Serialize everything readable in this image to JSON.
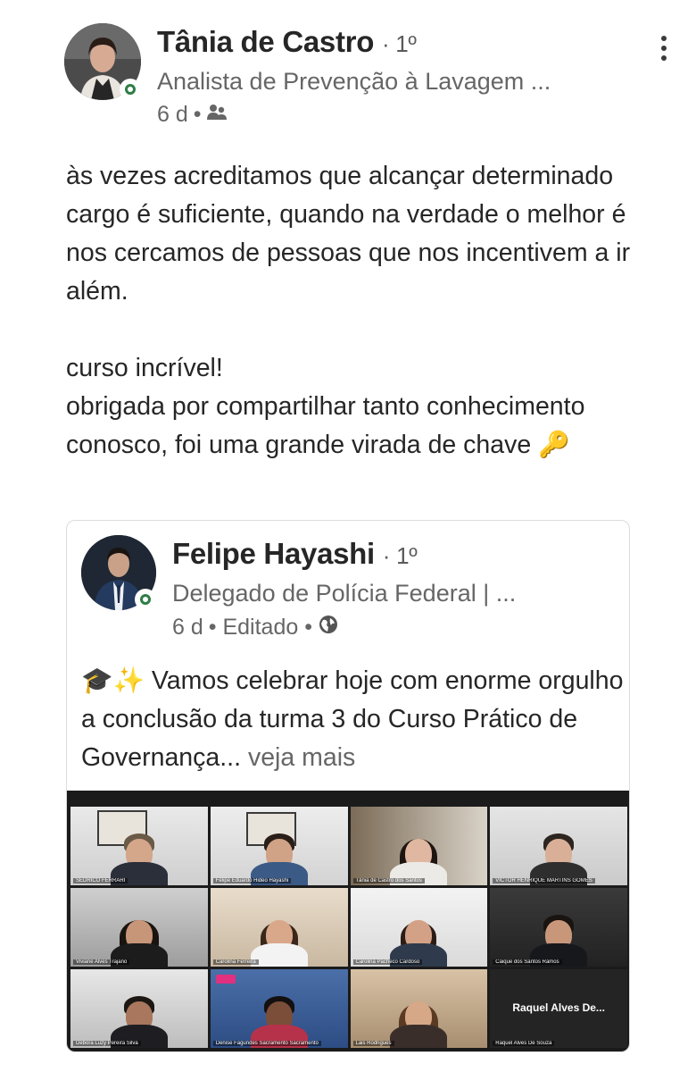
{
  "post": {
    "author": {
      "name": "Tânia de Castro",
      "degree": "· 1º",
      "headline": "Analista de Prevenção à Lavagem ...",
      "time": "6 d",
      "separator": "•",
      "visibility_icon": "connections-icon"
    },
    "text": "às vezes acreditamos que alcançar determinado cargo é suficiente, quando na verdade o melhor é nos cercamos de pessoas que nos incentivem a ir além.\n\ncurso incrível!\nobrigada por compartilhar tanto conhecimento conosco, foi uma grande virada de chave 🔑"
  },
  "shared": {
    "author": {
      "name": "Felipe Hayashi",
      "degree": "· 1º",
      "headline": "Delegado de Polícia Federal | ...",
      "time": "6 d",
      "edited": "• Editado •",
      "visibility_icon": "globe-icon"
    },
    "text": "🎓✨ Vamos celebrar hoje com enorme orgulho a conclusão da turma 3 do Curso Prático de Governança...",
    "see_more": "veja mais"
  },
  "video_grid": {
    "participants": [
      "SEDRICO FERRARI",
      "Felipe Eduardo Hideo Hayashi",
      "Tânia de Castro dos Santos",
      "VICTOR HENRIQUE MARTINS GOMES",
      "Viviane Alves Trajano",
      "Carolina Ferreira",
      "Carolina Pacheco Cardoso",
      "Caique dos Santos Ramos",
      "Debora Luzy Pereira Silva",
      "Denise Fagundes Sacramento Sacramento",
      "Lais Rodrigues",
      "Raquel Alves De Souza"
    ],
    "camera_off_label": "Raquel Alves De..."
  },
  "colors": {
    "online": "#2e7d46",
    "text": "#262626",
    "secondary": "#666666",
    "grid_bg": "#1b1b1b",
    "active_speaker": "#c9d36a"
  }
}
